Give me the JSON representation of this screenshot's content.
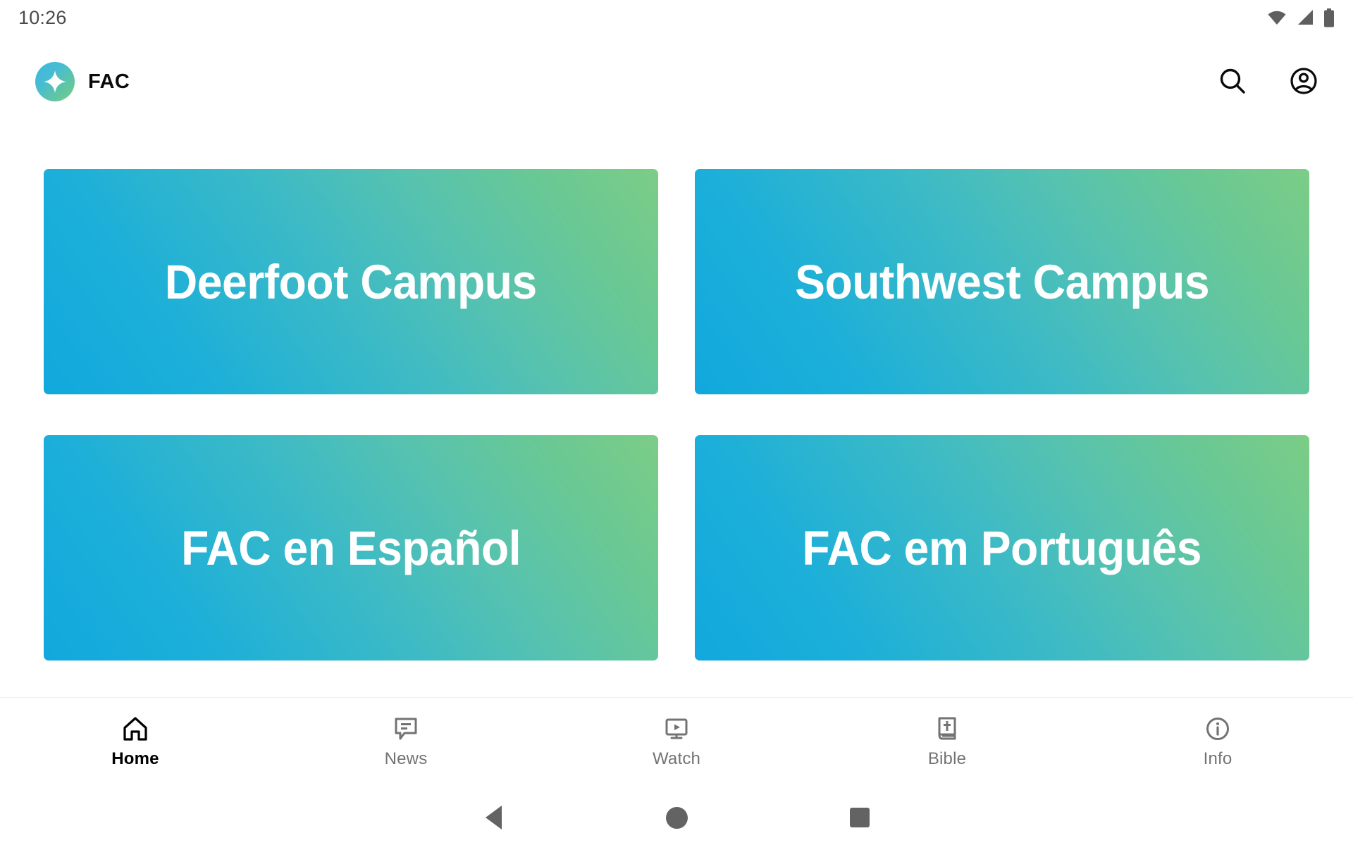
{
  "status_bar": {
    "time": "10:26",
    "icons": [
      "wifi-icon",
      "cellular-signal-icon",
      "battery-icon"
    ]
  },
  "header": {
    "app_name": "FAC",
    "logo_icon": "sparkle-star-logo",
    "actions": [
      {
        "name": "search",
        "icon": "search-icon"
      },
      {
        "name": "account",
        "icon": "account-circle-icon"
      }
    ]
  },
  "main": {
    "tiles": [
      {
        "label": "Deerfoot Campus"
      },
      {
        "label": "Southwest Campus"
      },
      {
        "label": "FAC en Español"
      },
      {
        "label": "FAC em Português"
      }
    ]
  },
  "bottom_nav": {
    "items": [
      {
        "label": "Home",
        "icon": "home-icon",
        "active": true
      },
      {
        "label": "News",
        "icon": "message-icon",
        "active": false
      },
      {
        "label": "Watch",
        "icon": "video-icon",
        "active": false
      },
      {
        "label": "Bible",
        "icon": "bible-icon",
        "active": false
      },
      {
        "label": "Info",
        "icon": "info-icon",
        "active": false
      }
    ]
  },
  "system_nav": {
    "back": "back-button",
    "home": "home-button",
    "recents": "recents-button"
  },
  "colors": {
    "gradient_start": "#11a8dd",
    "gradient_end": "#7ccd86",
    "active_nav": "#000000",
    "inactive_nav": "#737373"
  }
}
